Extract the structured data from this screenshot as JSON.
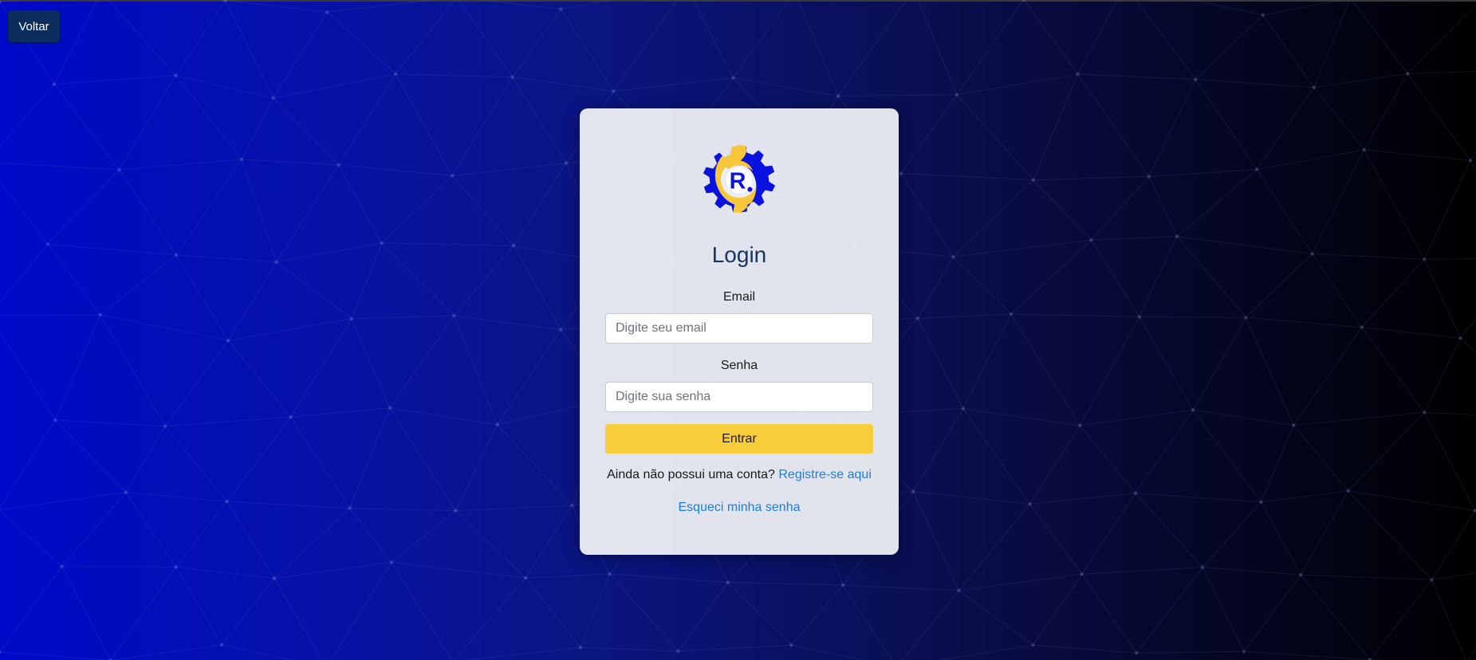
{
  "nav": {
    "back_label": "Voltar"
  },
  "login": {
    "title": "Login",
    "email_label": "Email",
    "email_placeholder": "Digite seu email",
    "email_value": "",
    "password_label": "Senha",
    "password_placeholder": "Digite sua senha",
    "password_value": "",
    "submit_label": "Entrar",
    "signup_prompt": "Ainda não possui uma conta?",
    "signup_link": "Registre-se aqui",
    "forgot_link": "Esqueci minha senha"
  },
  "logo": {
    "letter": "R",
    "icon": "gear-logo-icon"
  },
  "colors": {
    "background_left": "#0009c8",
    "background_right": "#000000",
    "card_bg": "#ebedf3",
    "title": "#153565",
    "back_button": "#0b2d5e",
    "submit_button": "#f7cd3b",
    "link": "#1a7ee0",
    "logo_blue": "#0a12e0",
    "logo_yellow": "#f7c63a"
  }
}
